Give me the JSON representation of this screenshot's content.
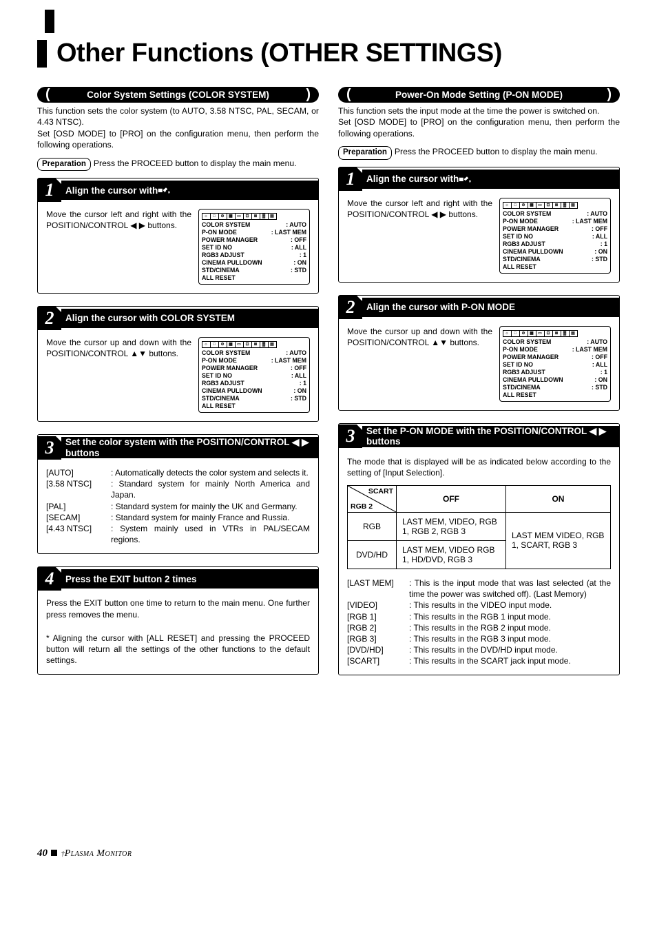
{
  "title": "Other Functions (OTHER SETTINGS)",
  "left": {
    "header": "Color System Settings (COLOR SYSTEM)",
    "intro1": "This function sets the color system (to AUTO, 3.58 NTSC, PAL, SECAM, or 4.43 NTSC).",
    "intro2": "Set [OSD MODE] to [PRO] on the configuration menu, then perform the following operations.",
    "prep_label": "Preparation",
    "prep_text": "Press the PROCEED button to display the main menu.",
    "steps": [
      {
        "num": "1",
        "title_pre": "Align the cursor with ",
        "title_post": "",
        "has_icon": true,
        "text": "Move the cursor left and right with the POSITION/CONTROL ◀ ▶ buttons."
      },
      {
        "num": "2",
        "title_pre": "Align the cursor with COLOR SYSTEM",
        "title_post": "",
        "has_icon": false,
        "text": "Move the cursor up and down with the POSITION/CONTROL ▲▼ buttons."
      },
      {
        "num": "3",
        "title_pre": "Set the color system with the POSITION/CONTROL ◀ ▶ buttons",
        "title_post": "",
        "has_icon": false,
        "text": ""
      },
      {
        "num": "4",
        "title_pre": "Press the EXIT button 2 times",
        "title_post": "",
        "has_icon": false,
        "text": ""
      }
    ],
    "options": [
      {
        "k": "[AUTO]",
        "v": ": Automatically detects the color system and selects it."
      },
      {
        "k": "[3.58 NTSC]",
        "v": ": Standard system for mainly North America and Japan."
      },
      {
        "k": "[PAL]",
        "v": ": Standard system for mainly the UK and Germany."
      },
      {
        "k": "[SECAM]",
        "v": ": Standard system for mainly France and Russia."
      },
      {
        "k": "[4.43 NTSC]",
        "v": ": System mainly used in VTRs in PAL/SECAM regions."
      }
    ],
    "exit_text": "Press the EXIT button one time to return to the main menu. One further press removes the menu.",
    "reset_note": "* Aligning the cursor with [ALL RESET] and pressing the PROCEED button will return all the settings of the other functions to the default settings."
  },
  "right": {
    "header": "Power-On Mode Setting (P-ON MODE)",
    "intro1": "This function sets the input mode at the time the power is switched on.",
    "intro2": "Set [OSD MODE] to [PRO] on the configuration menu, then perform the following operations.",
    "prep_label": "Preparation",
    "prep_text": "Press the PROCEED button to display the main menu.",
    "steps": [
      {
        "num": "1",
        "title_pre": "Align the cursor with ",
        "title_post": "",
        "has_icon": true,
        "text": "Move the cursor left and right with the POSITION/CONTROL ◀ ▶ buttons."
      },
      {
        "num": "2",
        "title_pre": "Align the cursor with P-ON MODE",
        "title_post": "",
        "has_icon": false,
        "text": "Move the cursor up and down with the POSITION/CONTROL ▲▼ buttons."
      },
      {
        "num": "3",
        "title_pre": "Set the P-ON MODE with the POSITION/CONTROL ◀ ▶ buttons",
        "title_post": "",
        "has_icon": false,
        "text": ""
      }
    ],
    "mode_intro": "The mode that is displayed will be as indicated below according to the setting of [Input Selection].",
    "table": {
      "diag_tl": "SCART",
      "diag_br": "RGB 2",
      "head_off": "OFF",
      "head_on": "ON",
      "row1_k": "RGB",
      "row1_off": "LAST MEM, VIDEO, RGB 1, RGB 2, RGB 3",
      "row2_k": "DVD/HD",
      "row2_off": "LAST MEM, VIDEO RGB 1, HD/DVD, RGB 3",
      "on_merged": "LAST MEM VIDEO, RGB 1, SCART, RGB 3"
    },
    "options": [
      {
        "k": "[LAST MEM]",
        "v": ": This is the input mode that was last selected (at the time the power was switched off). (Last Memory)"
      },
      {
        "k": "[VIDEO]",
        "v": ": This results in the VIDEO input mode."
      },
      {
        "k": "[RGB 1]",
        "v": ": This results in the RGB 1 input mode."
      },
      {
        "k": "[RGB 2]",
        "v": ": This results in the RGB 2 input mode."
      },
      {
        "k": "[RGB 3]",
        "v": ": This results in the RGB 3 input mode."
      },
      {
        "k": "[DVD/HD]",
        "v": ": This results in the DVD/HD input mode."
      },
      {
        "k": "[SCART]",
        "v": ": This results in the SCART jack input mode."
      }
    ]
  },
  "menu": {
    "rows": [
      {
        "k": "COLOR SYSTEM",
        "v": ": AUTO"
      },
      {
        "k": "P-ON MODE",
        "v": ": LAST MEM"
      },
      {
        "k": "POWER MANAGER",
        "v": ": OFF"
      },
      {
        "k": "SET ID NO",
        "v": ": ALL"
      },
      {
        "k": "RGB3 ADJUST",
        "v": ": 1"
      },
      {
        "k": "CINEMA PULLDOWN",
        "v": ": ON"
      },
      {
        "k": "STD/CINEMA",
        "v": ": STD"
      },
      {
        "k": "ALL RESET",
        "v": ""
      }
    ]
  },
  "footer": {
    "page_num": "40",
    "label": "Plasma Monitor"
  }
}
